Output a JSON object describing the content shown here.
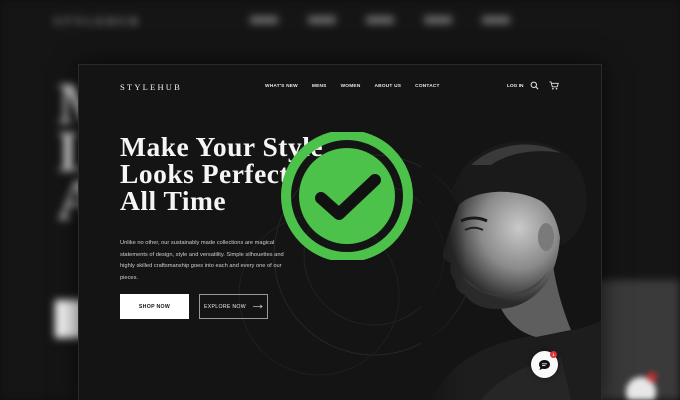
{
  "brand": {
    "logo": "STYLEHUB"
  },
  "nav": {
    "links": [
      "WHAT'S NEW",
      "MENS",
      "WOMEN",
      "ABOUT US",
      "CONTACT"
    ],
    "login": "LOG IN"
  },
  "hero": {
    "headline_lines": [
      "Make Your Style",
      "Looks Perfect",
      "All Time"
    ],
    "body": "Unlike no other, our sustainably made collections are magical statements of design, style and versatility. Simple silhouettes and highly skilled craftsmanship goes into each and every one of our pieces.",
    "shop_button": "SHOP NOW",
    "explore_button": "EXPLORE NOW"
  },
  "chat": {
    "badge": "1"
  },
  "icons": {
    "search": "search-icon",
    "cart": "cart-icon",
    "arrow": "arrow-right-icon",
    "chat": "chat-bubble-icon",
    "check": "checkmark-circle-icon"
  },
  "colors": {
    "background": "#141414",
    "text": "#f5f5f5",
    "check_green": "#4cc24a",
    "badge_red": "#e0302f"
  }
}
